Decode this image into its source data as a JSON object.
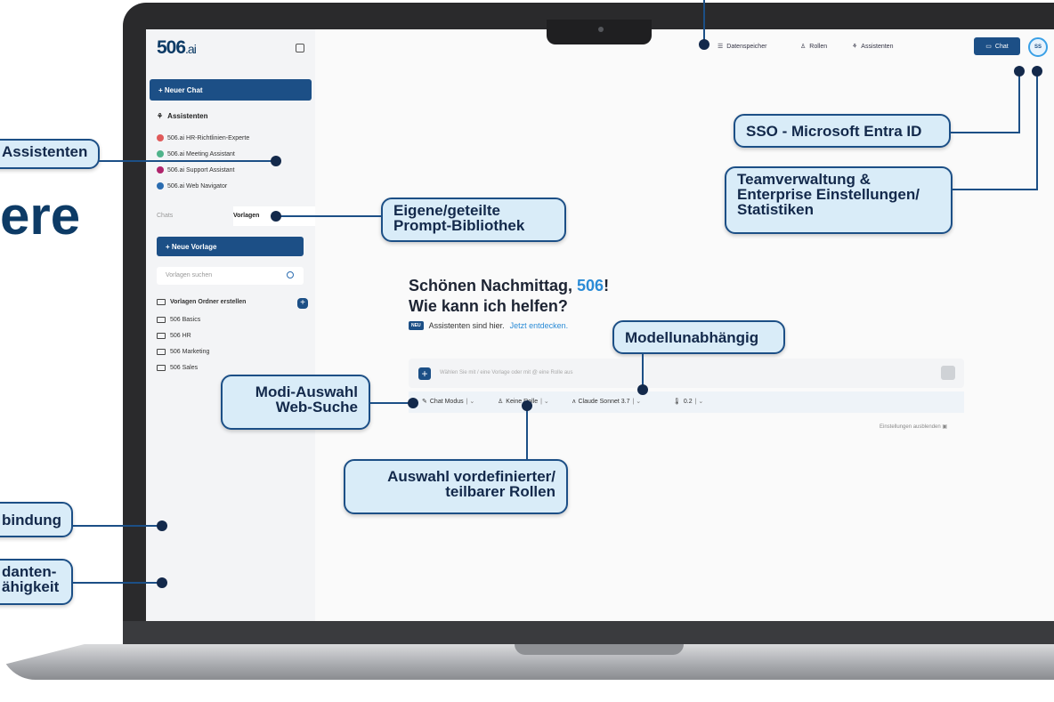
{
  "app": {
    "logo": "506",
    "logo_suffix": ".ai"
  },
  "sidebar": {
    "new_chat": "+ Neuer Chat",
    "assistants_title": "Assistenten",
    "assistants": [
      {
        "label": "506.ai HR-Richtlinien-Experte",
        "color": "#e05a5a"
      },
      {
        "label": "506.ai Meeting Assistant",
        "color": "#4fb38a"
      },
      {
        "label": "506.ai Support Assistant",
        "color": "#b0246c"
      },
      {
        "label": "506.ai Web Navigator",
        "color": "#2b6cb0"
      }
    ],
    "tabs": {
      "chats": "Chats",
      "templates": "Vorlagen"
    },
    "new_template": "+ Neue Vorlage",
    "search_placeholder": "Vorlagen suchen",
    "create_folder": "Vorlagen Ordner erstellen",
    "folders": [
      "506 Basics",
      "506 HR",
      "506 Marketing",
      "506 Sales"
    ]
  },
  "topbar": {
    "datastore": "Datenspeicher",
    "roles": "Rollen",
    "assistants": "Assistenten",
    "chat_button": "Chat",
    "avatar": "SS"
  },
  "main": {
    "greeting_prefix": "Schönen Nachmittag, ",
    "greeting_name": "506",
    "greeting_suffix": "!",
    "subheading": "Wie kann ich helfen?",
    "news_badge": "NEU",
    "news_text": "Assistenten sind hier.",
    "news_link": "Jetzt entdecken.",
    "input_placeholder": "Wählen Sie mit / eine Vorlage oder mit @ eine Rolle aus",
    "options": {
      "mode": "Chat Modus",
      "role": "Keine Rolle",
      "model": "Claude Sonnet 3.7",
      "temperature": "0.2"
    },
    "hide_settings": "Einstellungen ausblenden"
  },
  "callouts": {
    "assistants": "Assistenten",
    "prompt_library_1": "Eigene/geteilte",
    "prompt_library_2": "Prompt-Bibliothek",
    "sso": "SSO - Microsoft Entra ID",
    "team_1": "Teamverwaltung &",
    "team_2": "Enterprise Einstellungen/",
    "team_3": "Statistiken",
    "model_agnostic": "Modellunabhängig",
    "mode_1": "Modi-Auswahl",
    "mode_2": "Web-Suche",
    "roles_1": "Auswahl vordefinierter/",
    "roles_2": "teilbarer Rollen",
    "binding": "bindung",
    "tenant_1": "danten-",
    "tenant_2": "ähigkeit",
    "big_fragment": "ere"
  }
}
